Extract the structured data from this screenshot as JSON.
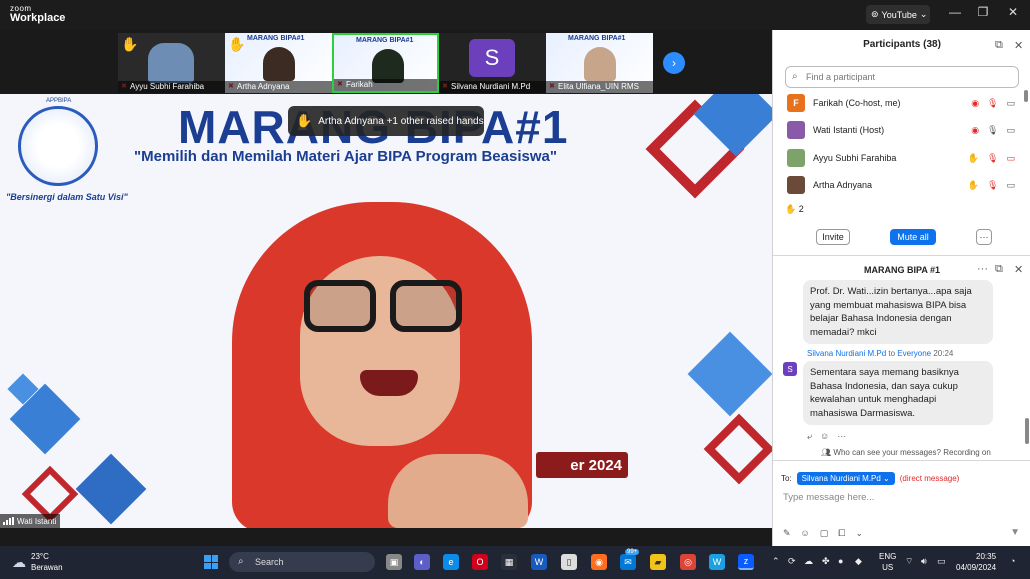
{
  "window": {
    "brand_top": "zoom",
    "brand_bottom": "Workplace",
    "youtube_label": "YouTube",
    "controls": [
      "—",
      "❐",
      "✕"
    ]
  },
  "thumbnails": [
    {
      "name": "Ayyu Subhi Farahiba",
      "raised_hand": true
    },
    {
      "name": "Artha Adnyana",
      "raised_hand": true,
      "banner": "MARANG BIPA#1"
    },
    {
      "name": "Farikah",
      "banner": "MARANG BIPA#1"
    },
    {
      "name": "Silvana Nurdiani M.Pd",
      "avatar_letter": "S"
    },
    {
      "name": "Elita Ulfiana_UIN RMS",
      "banner": "MARANG BIPA#1"
    }
  ],
  "main_video": {
    "title": "MARANG BIPA#1",
    "subtitle": "\"Memilih dan Memilah Materi Ajar BIPA Program Beasiswa\"",
    "emblem_top": "APPBIPA",
    "motto": "\"Bersinergi dalam Satu Visi\"",
    "raised_hands_banner": "Artha Adnyana +1 other raised hands",
    "date_fragment": "er 2024",
    "speaker_name": "Wati Istanti"
  },
  "participants_panel": {
    "title": "Participants (38)",
    "search_placeholder": "Find a participant",
    "participants": [
      {
        "initial": "F",
        "name": "Farikah (Co-host, me)",
        "color": "#e8711c"
      },
      {
        "initial": "",
        "name": "Wati Istanti (Host)",
        "color": "#8a5aa8"
      },
      {
        "initial": "",
        "name": "Ayyu Subhi Farahiba",
        "color": "#7ea36a"
      },
      {
        "initial": "",
        "name": "Artha Adnyana",
        "color": "#6b4a3a"
      }
    ],
    "raised_hands_count": "2",
    "invite_label": "Invite",
    "mute_all_label": "Mute all",
    "more_label": "···"
  },
  "chat": {
    "title": "MARANG BIPA #1",
    "messages": [
      {
        "text": "Prof. Dr. Wati...izin bertanya...apa saja yang membuat mahasiswa BIPA bisa belajar Bahasa Indonesia dengan memadai? mkci"
      },
      {
        "sender": "Silvana Nurdiani M.Pd",
        "to_word": "to",
        "recipient": "Everyone",
        "time": "20:24",
        "avatar": "S",
        "text": "Sementara saya memang basiknya Bahasa Indonesia, dan saya cukup kewalahan untuk menghadapi mahasiswa Darmasiswa."
      }
    ],
    "who_can_see": "Who can see your messages? Recording on",
    "to_label": "To:",
    "to_recipient": "Silvana Nurdiani M.Pd",
    "direct_label": "(direct message)",
    "input_placeholder": "Type message here..."
  },
  "taskbar": {
    "temperature": "23°C",
    "weather": "Berawan",
    "search_label": "Search",
    "notification_badge": "99+",
    "lang_top": "ENG",
    "lang_bottom": "US",
    "time": "20:35",
    "date": "04/09/2024"
  },
  "colors": {
    "accent": "#0e72ed",
    "raised_hand": "#f5c518",
    "mute_red": "#e02828",
    "slide_blue": "#1b3e92"
  }
}
